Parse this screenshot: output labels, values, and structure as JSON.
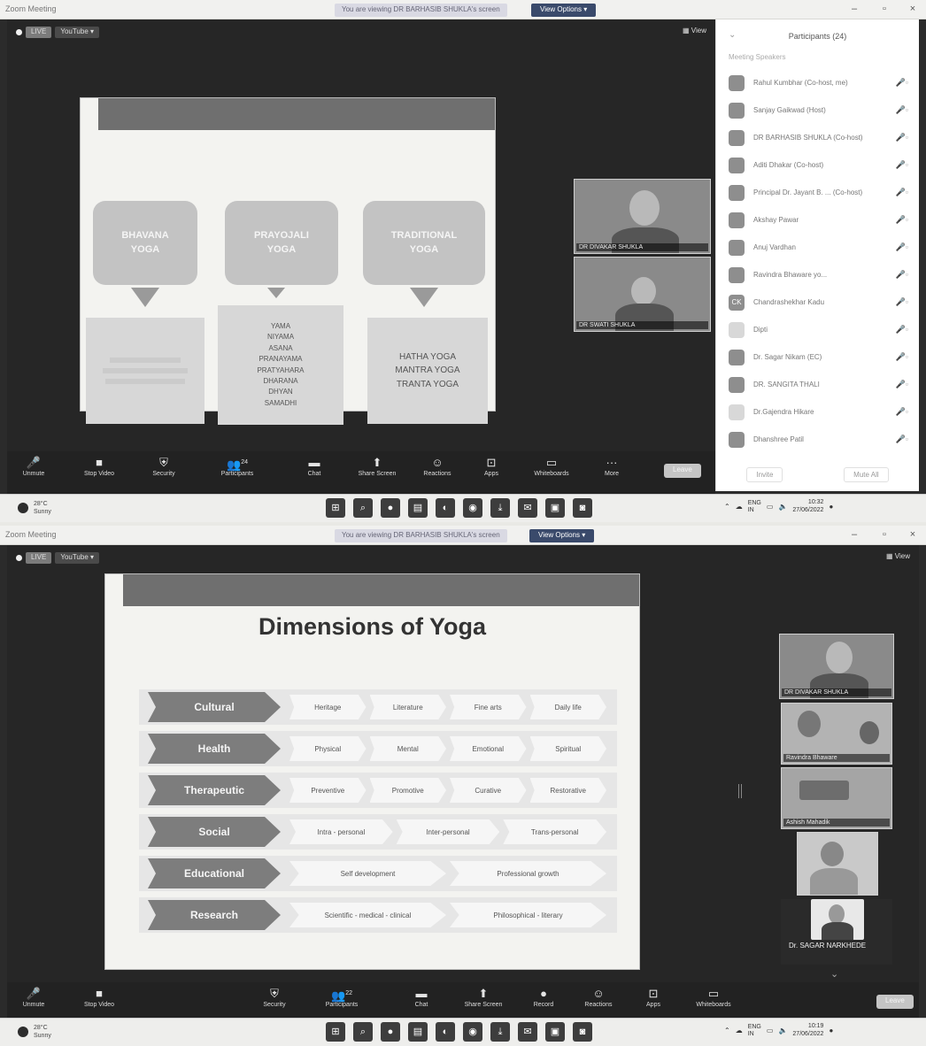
{
  "window": {
    "app_title": "Zoom Meeting",
    "view_options": "View Options ▾"
  },
  "screens": [
    {
      "share_note": "You are viewing DR BARHASIB SHUKLA's screen",
      "chips": {
        "record": "LIVE",
        "platform": "YouTube ▾"
      },
      "view_label": "▦ View",
      "slide": {
        "boxes": [
          "BHAVANA\nYOGA",
          "PRAYOJALI\nYOGA",
          "TRADITIONAL\nYOGA"
        ],
        "lists": {
          "middle": [
            "YAMA",
            "NIYAMA",
            "ASANA",
            "PRANAYAMA",
            "PRATYAHARA",
            "DHARANA",
            "DHYAN",
            "SAMADHI"
          ],
          "right": [
            "HATHA YOGA",
            "MANTRA YOGA",
            "TRANTA YOGA"
          ]
        }
      },
      "tiles": [
        {
          "name": "DR DIVAKAR SHUKLA"
        },
        {
          "name": "DR SWATI SHUKLA"
        }
      ],
      "participants_panel": {
        "title": "Participants (24)",
        "section": "Meeting Speakers",
        "entries": [
          {
            "initial": "",
            "name": "Rahul Kumbhar (Co-host, me)"
          },
          {
            "initial": "",
            "name": "Sanjay Gaikwad (Host)"
          },
          {
            "initial": "",
            "name": "DR BARHASIB SHUKLA (Co-host)"
          },
          {
            "initial": "",
            "name": "Aditi Dhakar (Co-host)"
          },
          {
            "initial": "",
            "name": "Principal Dr. Jayant B. ... (Co-host)"
          },
          {
            "initial": "",
            "name": "Akshay Pawar"
          },
          {
            "initial": "",
            "name": "Anuj Vardhan"
          },
          {
            "initial": "",
            "name": "Ravindra Bhaware yo..."
          },
          {
            "initial": "CK",
            "name": "Chandrashekhar Kadu"
          },
          {
            "initial": "",
            "name": "Dipti"
          },
          {
            "initial": "",
            "name": "Dr. Sagar Nikam (EC)"
          },
          {
            "initial": "",
            "name": "DR. SANGITA THALI"
          },
          {
            "initial": "",
            "name": "Dr.Gajendra Hikare"
          },
          {
            "initial": "",
            "name": "Dhanshree Patil"
          }
        ],
        "invite": "Invite",
        "mute_all": "Mute All"
      },
      "toolbar": {
        "unmute": "Unmute",
        "stop_video": "Stop Video",
        "security": "Security",
        "participants": "Participants",
        "participants_count": "24",
        "chat": "Chat",
        "share_screen": "Share Screen",
        "reactions": "Reactions",
        "apps": "Apps",
        "whiteboards": "Whiteboards",
        "more": "More",
        "leave": "Leave"
      },
      "taskbar": {
        "temp": "28°C",
        "condition": "Sunny",
        "lang1": "ENG",
        "lang2": "IN",
        "time": "10:32",
        "date": "27/06/2022"
      }
    },
    {
      "share_note": "You are viewing DR BARHASIB SHUKLA's screen",
      "chips": {
        "record": "LIVE",
        "platform": "YouTube ▾"
      },
      "view_label": "▦ View",
      "slide": {
        "title": "Dimensions of Yoga",
        "rows": [
          {
            "head": "Cultural",
            "items": [
              "Heritage",
              "Literature",
              "Fine arts",
              "Daily life"
            ]
          },
          {
            "head": "Health",
            "items": [
              "Physical",
              "Mental",
              "Emotional",
              "Spiritual"
            ]
          },
          {
            "head": "Therapeutic",
            "items": [
              "Preventive",
              "Promotive",
              "Curative",
              "Restorative"
            ]
          },
          {
            "head": "Social",
            "items": [
              "Intra - personal",
              "Inter-personal",
              "Trans-personal"
            ]
          },
          {
            "head": "Educational",
            "items": [
              "Self development",
              "Professional growth"
            ]
          },
          {
            "head": "Research",
            "items": [
              "Scientific - medical - clinical",
              "Philosophical - literary"
            ]
          }
        ]
      },
      "tiles": [
        {
          "name": "DR DIVAKAR SHUKLA"
        },
        {
          "name": "Ravindra Bhaware"
        },
        {
          "name": "Ashish Mahadik"
        },
        {
          "name": ""
        },
        {
          "name": "Dr. SAGAR NARKHEDE"
        }
      ],
      "toolbar": {
        "unmute": "Unmute",
        "stop_video": "Stop Video",
        "security": "Security",
        "participants": "Participants",
        "participants_count": "22",
        "chat": "Chat",
        "share_screen": "Share Screen",
        "record": "Record",
        "reactions": "Reactions",
        "apps": "Apps",
        "whiteboards": "Whiteboards",
        "leave": "Leave"
      },
      "taskbar": {
        "temp": "28°C",
        "condition": "Sunny",
        "lang1": "ENG",
        "lang2": "IN",
        "time": "10:19",
        "date": "27/06/2022"
      }
    }
  ]
}
